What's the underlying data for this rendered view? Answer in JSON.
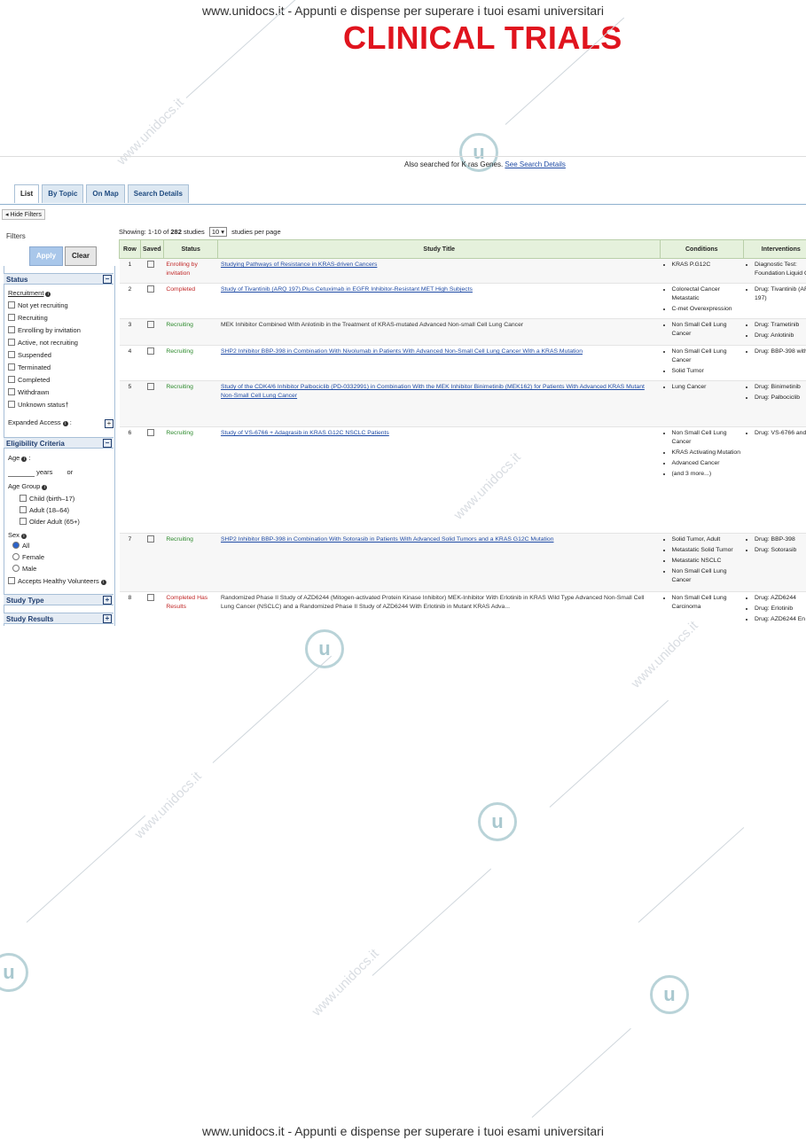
{
  "banner": "www.unidocs.it - Appunti e dispense per superare i tuoi esami universitari",
  "doc_title": "CLINICAL TRIALS",
  "watermark": "www.unidocs.it",
  "also_searched": {
    "prefix": "Also searched for K ras Genes.",
    "link": "See Search Details"
  },
  "tabs": [
    "List",
    "By Topic",
    "On Map",
    "Search Details"
  ],
  "hide_filters": "Hide Filters",
  "filters": {
    "title": "Filters",
    "apply": "Apply",
    "clear": "Clear",
    "status_header": "Status",
    "recruitment_label": "Recruitment",
    "recruitment_options": [
      "Not yet recruiting",
      "Recruiting",
      "Enrolling by invitation",
      "Active, not recruiting",
      "Suspended",
      "Terminated",
      "Completed",
      "Withdrawn",
      "Unknown status†"
    ],
    "expanded_access": "Expanded Access",
    "eligibility_header": "Eligibility Criteria",
    "age_label": "Age",
    "years_label": "years",
    "or_label": "or",
    "age_group_label": "Age Group",
    "age_group_options": [
      "Child (birth–17)",
      "Adult (18–64)",
      "Older Adult (65+)"
    ],
    "sex_label": "Sex",
    "sex_options": [
      "All",
      "Female",
      "Male"
    ],
    "healthy_volunteers": "Accepts Healthy Volunteers",
    "study_type_header": "Study Type",
    "study_results_header": "Study Results"
  },
  "results": {
    "showing_prefix": "Showing: 1-10 of",
    "total": "282",
    "showing_suffix": "studies",
    "per_page_value": "10",
    "per_page_label": "studies per page",
    "headers": [
      "Row",
      "Saved",
      "Status",
      "Study Title",
      "Conditions",
      "Interventions"
    ],
    "rows": [
      {
        "row": "1",
        "status": "Enrolling by invitation",
        "status_color": "red",
        "title": "Studying Pathways of Resistance in KRAS-driven Cancers",
        "conditions": [
          "KRAS P.G12C"
        ],
        "interventions": [
          "Diagnostic Test: Foundation Liquid CDx"
        ]
      },
      {
        "row": "2",
        "status": "Completed",
        "status_color": "red",
        "title": "Study of Tivantinib (ARQ 197) Plus Cetuximab in EGFR Inhibitor-Resistant MET High Subjects",
        "conditions": [
          "Colorectal Cancer Metastatic",
          "C-met Overexpression"
        ],
        "interventions": [
          "Drug: Tivantinib (ARQ 197)"
        ]
      },
      {
        "row": "3",
        "status": "Recruiting",
        "status_color": "green",
        "title": "MEK Inhibitor Combined With Anlotinib in the Treatment of KRAS-mutated Advanced Non-small Cell Lung Cancer",
        "conditions": [
          "Non Small Cell Lung Cancer"
        ],
        "interventions": [
          "Drug: Trametinib",
          "Drug: Anlotinib"
        ]
      },
      {
        "row": "4",
        "status": "Recruiting",
        "status_color": "green",
        "title": "SHP2 Inhibitor BBP-398 in Combination With Nivolumab in Patients With Advanced Non-Small Cell Lung Cancer With a KRAS Mutation",
        "conditions": [
          "Non Small Cell Lung Cancer",
          "Solid Tumor"
        ],
        "interventions": [
          "Drug: BBP-398 with"
        ]
      },
      {
        "row": "5",
        "status": "Recruiting",
        "status_color": "green",
        "title": "Study of the CDK4/6 Inhibitor Palbociclib (PD-0332991) in Combination With the MEK Inhibitor Binimetinib (MEK162) for Patients With Advanced KRAS Mutant Non-Small Cell Lung Cancer",
        "conditions": [
          "Lung Cancer"
        ],
        "interventions": [
          "Drug: Binimetinib",
          "Drug: Palbociclib"
        ]
      },
      {
        "row": "6",
        "status": "Recruiting",
        "status_color": "green",
        "title": "Study of VS-6766 + Adagrasib in KRAS G12C NSCLC Patients",
        "conditions": [
          "Non Small Cell Lung Cancer",
          "KRAS Activating Mutation",
          "Advanced Cancer",
          "(and 3 more...)"
        ],
        "interventions": [
          "Drug: VS-6766 and"
        ]
      },
      {
        "row": "7",
        "status": "Recruiting",
        "status_color": "green",
        "title": "SHP2 Inhibitor BBP-398 in Combination With Sotorasib in Patients With Advanced Solid Tumors and a KRAS G12C Mutation",
        "conditions": [
          "Solid Tumor, Adult",
          "Metastatic Solid Tumor",
          "Metastatic NSCLC",
          "Non Small Cell Lung Cancer"
        ],
        "interventions": [
          "Drug: BBP-398",
          "Drug: Sotorasib"
        ]
      },
      {
        "row": "8",
        "status": "Completed Has Results",
        "status_color": "red",
        "title": "Randomized Phase II Study of AZD6244 (Mitogen-activated Protein Kinase Inhibitor) MEK-Inhibitor With Erlotinib in KRAS Wild Type Advanced Non-Small Cell Lung Cancer (NSCLC) and a Randomized Phase II Study of AZD6244 With Erlotinib in Mutant KRAS Adva...",
        "conditions": [
          "Non Small Cell Lung Carcinoma"
        ],
        "interventions": [
          "Drug: AZD6244",
          "Drug: Erlotinib",
          "Drug: AZD6244 En"
        ]
      }
    ]
  }
}
